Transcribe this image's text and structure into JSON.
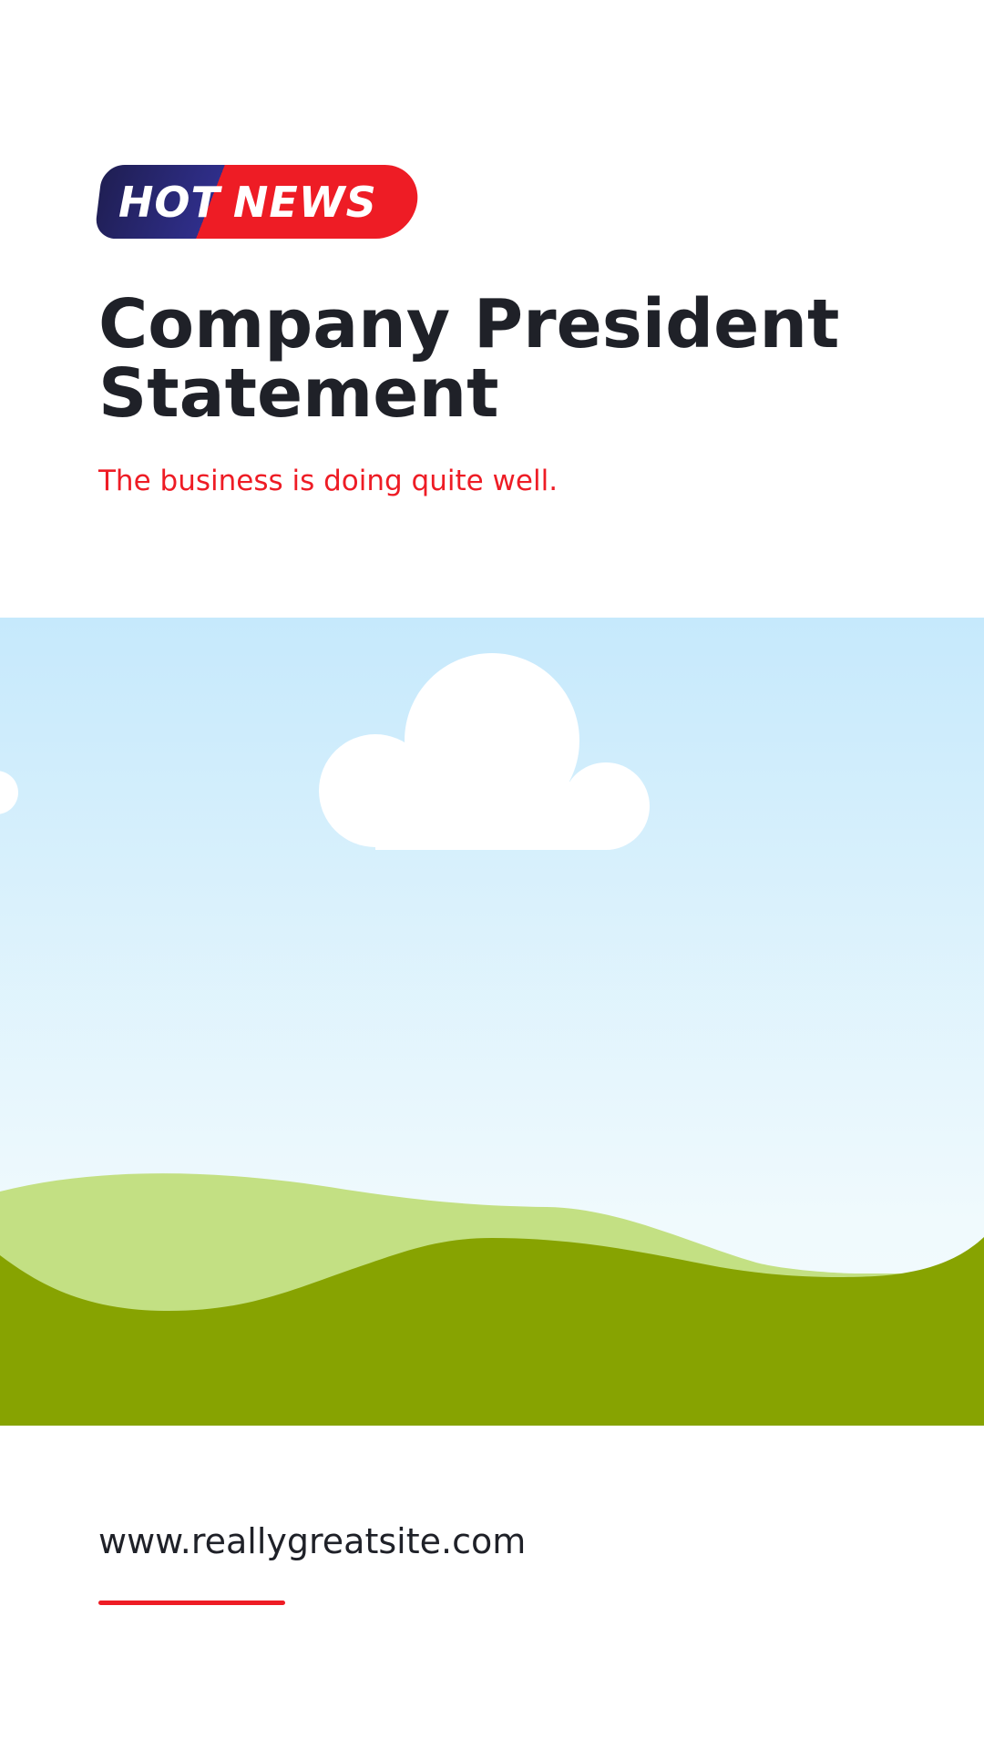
{
  "badge": {
    "word_one": "HOT",
    "word_two": "NEWS",
    "colors": {
      "left": "#2f2e8a",
      "right": "#ee1c25",
      "text": "#ffffff"
    }
  },
  "headline": {
    "title": "Company President Statement",
    "subtitle": "The business is doing quite well."
  },
  "illustration": {
    "icon": "landscape-illustration",
    "colors": {
      "sky_top": "#c6e9fc",
      "sky_bottom": "#f0fafd",
      "cloud": "#ffffff",
      "hill_back": "#c3e083",
      "hill_front": "#87a301"
    }
  },
  "footer": {
    "website": "www.reallygreatsite.com",
    "accent_color": "#ee1c25"
  },
  "colors": {
    "text_dark": "#1f2128",
    "accent": "#ee1c25",
    "background": "#ffffff"
  }
}
